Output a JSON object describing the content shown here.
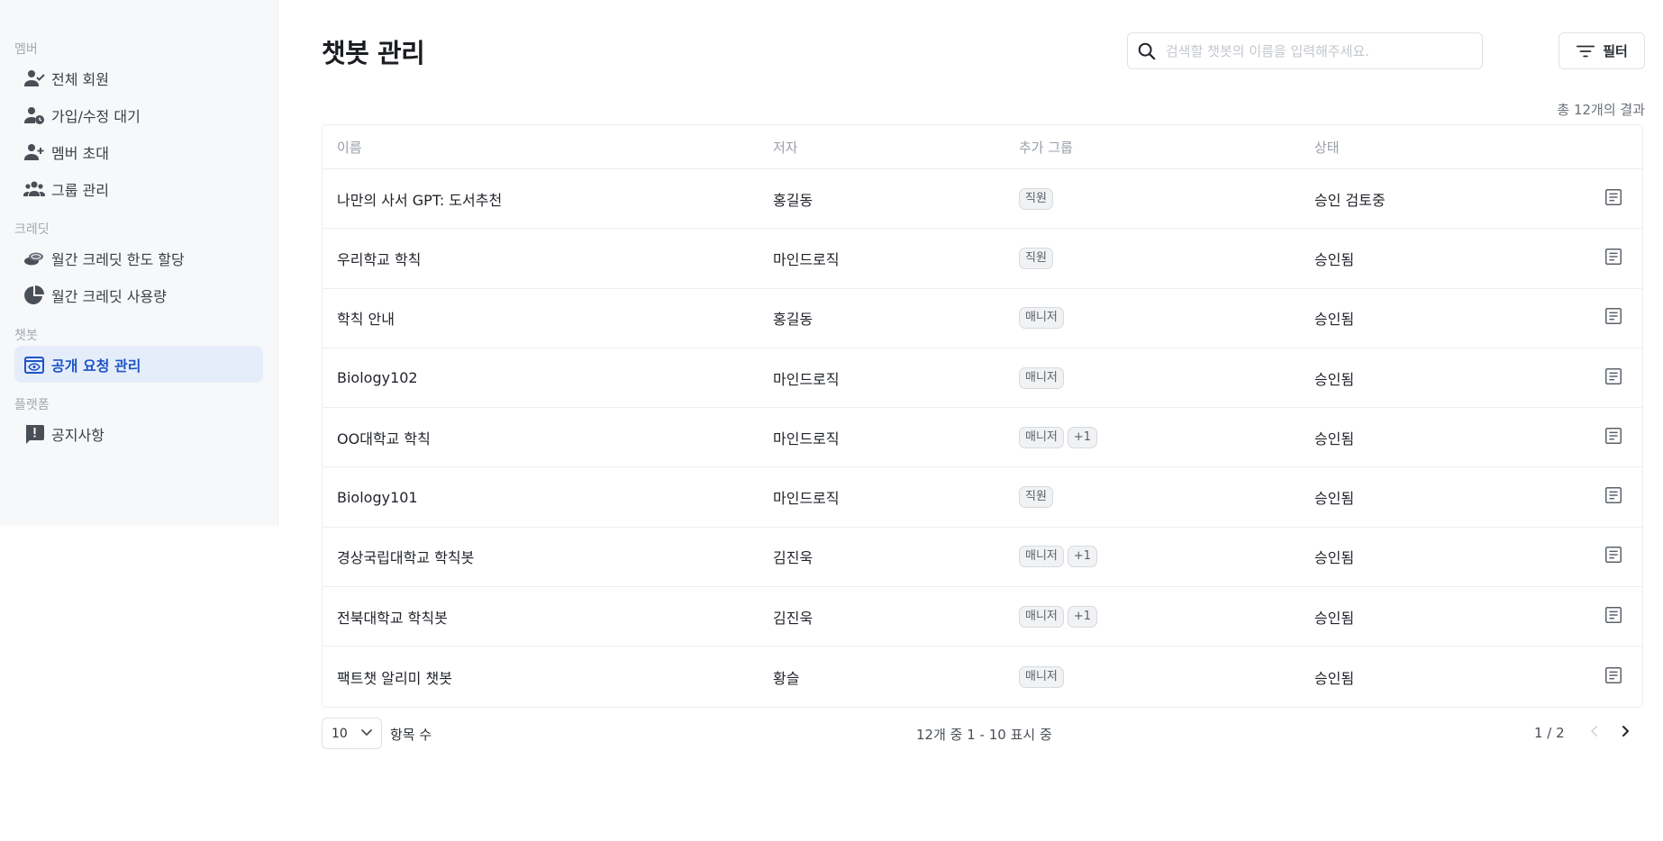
{
  "sidebar": {
    "sections": [
      {
        "label": "멤버",
        "items": [
          {
            "label": "전체 회원",
            "icon": "person-check-icon"
          },
          {
            "label": "가입/수정 대기",
            "icon": "person-clock-icon"
          },
          {
            "label": "멤버 초대",
            "icon": "person-add-icon"
          },
          {
            "label": "그룹 관리",
            "icon": "people-icon"
          }
        ]
      },
      {
        "label": "크레딧",
        "items": [
          {
            "label": "월간 크레딧 한도 할당",
            "icon": "coins-icon"
          },
          {
            "label": "월간 크레딧 사용량",
            "icon": "pie-chart-icon"
          }
        ]
      },
      {
        "label": "챗봇",
        "items": [
          {
            "label": "공개 요청 관리",
            "icon": "eye-panel-icon",
            "active": true
          }
        ]
      },
      {
        "label": "플랫폼",
        "items": [
          {
            "label": "공지사항",
            "icon": "announcement-icon"
          }
        ]
      }
    ]
  },
  "header": {
    "title": "챗봇 관리",
    "search_placeholder": "검색할 챗봇의 이름을 입력해주세요.",
    "search_value": "",
    "filter_label": "필터"
  },
  "result_count": "총 12개의 결과",
  "table": {
    "columns": [
      "이름",
      "저자",
      "추가 그룹",
      "상태"
    ],
    "rows": [
      {
        "name": "나만의 사서 GPT: 도서추천",
        "author": "홍길동",
        "groups": [
          "직원"
        ],
        "status": "승인 검토중"
      },
      {
        "name": "우리학교 학칙",
        "author": "마인드로직",
        "groups": [
          "직원"
        ],
        "status": "승인됨"
      },
      {
        "name": "학칙 안내",
        "author": "홍길동",
        "groups": [
          "매니저"
        ],
        "status": "승인됨"
      },
      {
        "name": "Biology102",
        "author": "마인드로직",
        "groups": [
          "매니저"
        ],
        "status": "승인됨"
      },
      {
        "name": "OO대학교 학칙",
        "author": "마인드로직",
        "groups": [
          "매니저",
          "+1"
        ],
        "status": "승인됨"
      },
      {
        "name": "Biology101",
        "author": "마인드로직",
        "groups": [
          "직원"
        ],
        "status": "승인됨"
      },
      {
        "name": "경상국립대학교 학칙봇",
        "author": "김진욱",
        "groups": [
          "매니저",
          "+1"
        ],
        "status": "승인됨"
      },
      {
        "name": "전북대학교 학칙봇",
        "author": "김진욱",
        "groups": [
          "매니저",
          "+1"
        ],
        "status": "승인됨"
      },
      {
        "name": "팩트챗 알리미 챗봇",
        "author": "황슬",
        "groups": [
          "매니저"
        ],
        "status": "승인됨"
      }
    ]
  },
  "pagination": {
    "page_size": "10",
    "page_size_label": "항목 수",
    "range_text": "12개 중 1 - 10 표시 중",
    "page_indicator": "1 / 2"
  },
  "colors": {
    "accent": "#1f54c7",
    "active_bg": "#e6edfa",
    "sidebar_bg": "#f7f8fa",
    "icon": "#4a4f57"
  }
}
